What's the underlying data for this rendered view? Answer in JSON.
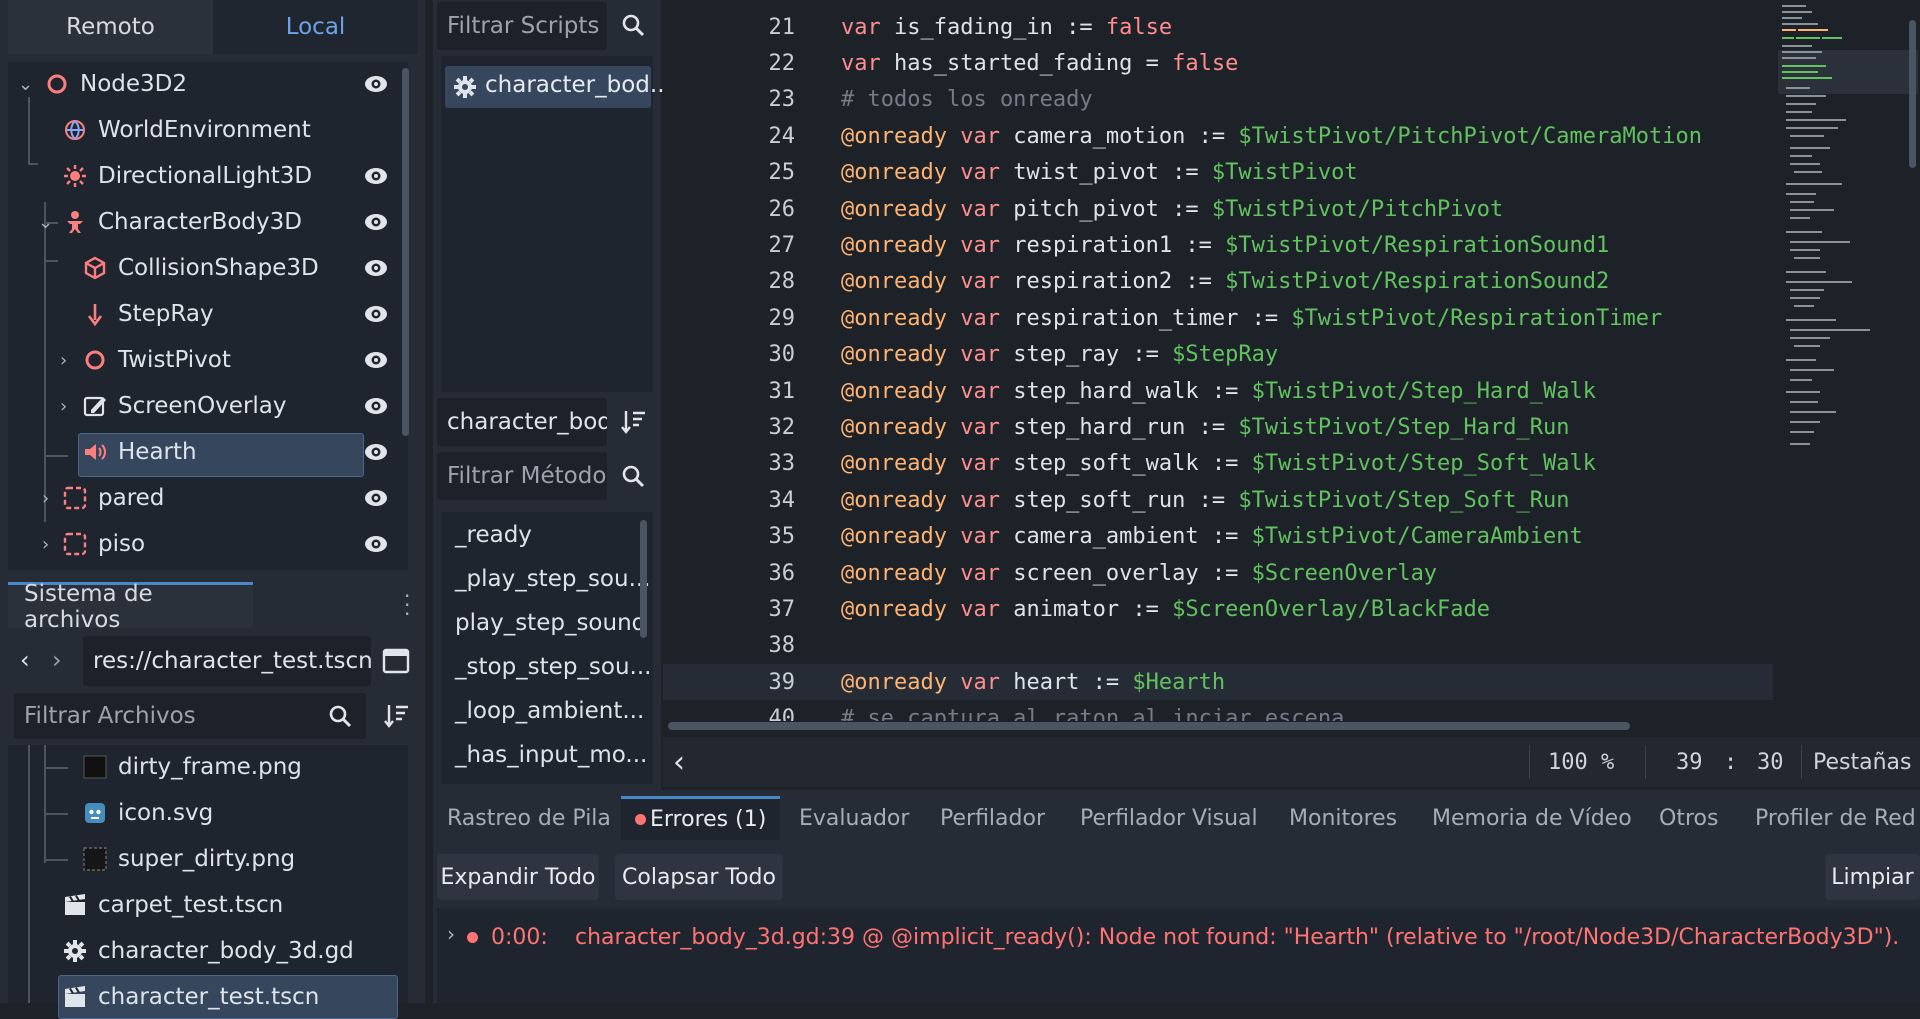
{
  "scene_dock": {
    "tabs": [
      {
        "label": "Remoto"
      },
      {
        "label": "Local"
      }
    ],
    "active_tab": "Local",
    "tree": [
      {
        "label": "Node3D2",
        "icon": "node3d-icon",
        "visible": true
      },
      {
        "label": "WorldEnvironment",
        "icon": "world-environment-icon",
        "visible": false
      },
      {
        "label": "DirectionalLight3D",
        "icon": "directional-light-icon",
        "visible": true
      },
      {
        "label": "CharacterBody3D",
        "icon": "character-body-icon",
        "visible": true
      },
      {
        "label": "CollisionShape3D",
        "icon": "collision-shape-icon",
        "visible": true
      },
      {
        "label": "StepRay",
        "icon": "ray-cast-icon",
        "visible": true
      },
      {
        "label": "TwistPivot",
        "icon": "node3d-icon",
        "visible": true
      },
      {
        "label": "ScreenOverlay",
        "icon": "screen-overlay-icon",
        "visible": true
      },
      {
        "label": "Hearth",
        "icon": "audio-player-icon",
        "visible": true,
        "selected": true
      },
      {
        "label": "pared",
        "icon": "instance-scene-icon",
        "visible": true
      },
      {
        "label": "piso",
        "icon": "instance-scene-icon",
        "visible": true
      }
    ]
  },
  "filesystem": {
    "tab_label": "Sistema de archivos",
    "path": "res://character_test.tscn",
    "filter_placeholder": "Filtrar Archivos",
    "files": [
      {
        "label": "dirty_frame.png",
        "icon": "image-file-icon"
      },
      {
        "label": "icon.svg",
        "icon": "svg-file-icon"
      },
      {
        "label": "super_dirty.png",
        "icon": "image-file-icon"
      },
      {
        "label": "carpet_test.tscn",
        "icon": "scene-file-icon"
      },
      {
        "label": "character_body_3d.gd",
        "icon": "script-gear-icon"
      },
      {
        "label": "character_test.tscn",
        "icon": "scene-file-icon",
        "selected": true
      }
    ]
  },
  "scripts_panel": {
    "filter_placeholder": "Filtrar Scripts",
    "scripts": [
      {
        "label": "character_bod..."
      }
    ],
    "current_script": "character_body",
    "method_filter_placeholder": "Filtrar Métodos",
    "methods": [
      "_ready",
      "_play_step_sou...",
      "play_step_sound",
      "_stop_step_sou...",
      "_loop_ambient...",
      "_has_input_mo..."
    ]
  },
  "editor": {
    "lines": [
      {
        "n": "21",
        "t": [
          [
            "kw",
            "var "
          ],
          [
            "id",
            "is_fading_in := "
          ],
          [
            "kw",
            "false"
          ]
        ]
      },
      {
        "n": "22",
        "t": [
          [
            "kw",
            "var "
          ],
          [
            "id",
            "has_started_fading = "
          ],
          [
            "kw",
            "false"
          ]
        ]
      },
      {
        "n": "23",
        "t": [
          [
            "cm",
            "# todos los onready"
          ]
        ]
      },
      {
        "n": "24",
        "t": [
          [
            "an",
            "@onready "
          ],
          [
            "kw",
            "var "
          ],
          [
            "id",
            "camera_motion := "
          ],
          [
            "np",
            "$TwistPivot/PitchPivot/CameraMotion"
          ]
        ]
      },
      {
        "n": "25",
        "t": [
          [
            "an",
            "@onready "
          ],
          [
            "kw",
            "var "
          ],
          [
            "id",
            "twist_pivot := "
          ],
          [
            "np",
            "$TwistPivot"
          ]
        ]
      },
      {
        "n": "26",
        "t": [
          [
            "an",
            "@onready "
          ],
          [
            "kw",
            "var "
          ],
          [
            "id",
            "pitch_pivot := "
          ],
          [
            "np",
            "$TwistPivot/PitchPivot"
          ]
        ]
      },
      {
        "n": "27",
        "t": [
          [
            "an",
            "@onready "
          ],
          [
            "kw",
            "var "
          ],
          [
            "id",
            "respiration1 := "
          ],
          [
            "np",
            "$TwistPivot/RespirationSound1"
          ]
        ]
      },
      {
        "n": "28",
        "t": [
          [
            "an",
            "@onready "
          ],
          [
            "kw",
            "var "
          ],
          [
            "id",
            "respiration2 := "
          ],
          [
            "np",
            "$TwistPivot/RespirationSound2"
          ]
        ]
      },
      {
        "n": "29",
        "t": [
          [
            "an",
            "@onready "
          ],
          [
            "kw",
            "var "
          ],
          [
            "id",
            "respiration_timer := "
          ],
          [
            "np",
            "$TwistPivot/RespirationTimer"
          ]
        ]
      },
      {
        "n": "30",
        "t": [
          [
            "an",
            "@onready "
          ],
          [
            "kw",
            "var "
          ],
          [
            "id",
            "step_ray := "
          ],
          [
            "np",
            "$StepRay"
          ]
        ]
      },
      {
        "n": "31",
        "t": [
          [
            "an",
            "@onready "
          ],
          [
            "kw",
            "var "
          ],
          [
            "id",
            "step_hard_walk := "
          ],
          [
            "np",
            "$TwistPivot/Step_Hard_Walk"
          ]
        ]
      },
      {
        "n": "32",
        "t": [
          [
            "an",
            "@onready "
          ],
          [
            "kw",
            "var "
          ],
          [
            "id",
            "step_hard_run := "
          ],
          [
            "np",
            "$TwistPivot/Step_Hard_Run"
          ]
        ]
      },
      {
        "n": "33",
        "t": [
          [
            "an",
            "@onready "
          ],
          [
            "kw",
            "var "
          ],
          [
            "id",
            "step_soft_walk := "
          ],
          [
            "np",
            "$TwistPivot/Step_Soft_Walk"
          ]
        ]
      },
      {
        "n": "34",
        "t": [
          [
            "an",
            "@onready "
          ],
          [
            "kw",
            "var "
          ],
          [
            "id",
            "step_soft_run := "
          ],
          [
            "np",
            "$TwistPivot/Step_Soft_Run"
          ]
        ]
      },
      {
        "n": "35",
        "t": [
          [
            "an",
            "@onready "
          ],
          [
            "kw",
            "var "
          ],
          [
            "id",
            "camera_ambient := "
          ],
          [
            "np",
            "$TwistPivot/CameraAmbient"
          ]
        ]
      },
      {
        "n": "36",
        "t": [
          [
            "an",
            "@onready "
          ],
          [
            "kw",
            "var "
          ],
          [
            "id",
            "screen_overlay := "
          ],
          [
            "np",
            "$ScreenOverlay"
          ]
        ]
      },
      {
        "n": "37",
        "t": [
          [
            "an",
            "@onready "
          ],
          [
            "kw",
            "var "
          ],
          [
            "id",
            "animator := "
          ],
          [
            "np",
            "$ScreenOverlay/BlackFade"
          ]
        ]
      },
      {
        "n": "38",
        "t": []
      },
      {
        "n": "39",
        "t": [
          [
            "an",
            "@onready "
          ],
          [
            "kw",
            "var "
          ],
          [
            "id",
            "heart := "
          ],
          [
            "np",
            "$Hearth"
          ]
        ],
        "current": true
      },
      {
        "n": "40",
        "t": [
          [
            "cm",
            "# se captura al raton al inciar escena"
          ]
        ]
      }
    ],
    "zoom": "100 %",
    "cursor_line": "39",
    "cursor_sep": ":",
    "cursor_col": "30",
    "indent_mode": "Pestañas"
  },
  "debugger": {
    "tabs": [
      "Rastreo de Pila",
      "Errores (1)",
      "Evaluador",
      "Perfilador",
      "Perfilador Visual",
      "Monitores",
      "Memoria de Vídeo",
      "Otros",
      "Profiler de Red"
    ],
    "active_tab": "Errores (1)",
    "expand_all": "Expandir Todo",
    "collapse_all": "Colapsar Todo",
    "clear": "Limpiar",
    "error_time": "0:00:",
    "error_message": "character_body_3d.gd:39 @ @implicit_ready(): Node not found: \"Hearth\" (relative to \"/root/Node3D/CharacterBody3D\")."
  },
  "colors": {
    "keyword": "#ff8d8d",
    "annotation": "#ffb373",
    "node_path": "#63c260",
    "comment": "#737c87",
    "accent": "#4b86c9",
    "error": "#ff7373"
  }
}
